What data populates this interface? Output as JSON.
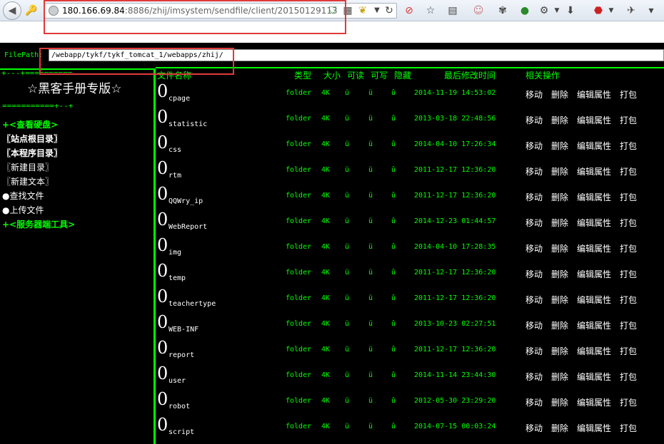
{
  "browser": {
    "url_host": "180.166.69.84",
    "url_rest": ":8886/zhij/imsystem/sendfile/client/20150129113"
  },
  "filepath": {
    "label": "FilePath:",
    "value": "/webapp/tykf/tykf_tomcat_1/webapps/zhij/"
  },
  "sidebar": {
    "title": "☆黑客手册专版☆",
    "dash_top": "+---+==========",
    "dash_bottom": "===========+--+",
    "items": [
      {
        "label": "+<查看硬盘>",
        "style": "green"
      },
      {
        "label": "〖站点根目录〗",
        "style": "white-bold"
      },
      {
        "label": "〖本程序目录〗",
        "style": "white-bold"
      },
      {
        "label": "〖新建目录〗",
        "style": "white"
      },
      {
        "label": "〖新建文本〗",
        "style": "white"
      },
      {
        "label": "●查找文件",
        "style": "white"
      },
      {
        "label": "●上传文件",
        "style": "white"
      },
      {
        "label": "+<服务器端工具>",
        "style": "green"
      }
    ]
  },
  "table": {
    "headers": {
      "name": "文件名称",
      "type": "类型",
      "size": "大小",
      "read": "可读",
      "write": "可写",
      "hidden": "隐藏",
      "modified": "最后修改时间",
      "ops": "相关操作"
    },
    "icon_char": "0",
    "perm_read": "ü",
    "perm_write": "ü",
    "perm_hidden": "û",
    "actions": [
      "移动",
      "删除",
      "编辑属性",
      "打包"
    ],
    "rows": [
      {
        "name": "cpage",
        "type": "folder",
        "size": "4K",
        "modified": "2014-11-19 14:53:02"
      },
      {
        "name": "statistic",
        "type": "folder",
        "size": "4K",
        "modified": "2013-03-18 22:48:56"
      },
      {
        "name": "css",
        "type": "folder",
        "size": "4K",
        "modified": "2014-04-10 17:26:34"
      },
      {
        "name": "rtm",
        "type": "folder",
        "size": "4K",
        "modified": "2011-12-17 12:36:20"
      },
      {
        "name": "QQWry_ip",
        "type": "folder",
        "size": "4K",
        "modified": "2011-12-17 12:36:20"
      },
      {
        "name": "WebReport",
        "type": "folder",
        "size": "4K",
        "modified": "2014-12-23 01:44:57"
      },
      {
        "name": "img",
        "type": "folder",
        "size": "4K",
        "modified": "2014-04-10 17:28:35"
      },
      {
        "name": "temp",
        "type": "folder",
        "size": "4K",
        "modified": "2011-12-17 12:36:20"
      },
      {
        "name": "teachertype",
        "type": "folder",
        "size": "4K",
        "modified": "2011-12-17 12:36:20"
      },
      {
        "name": "WEB-INF",
        "type": "folder",
        "size": "4K",
        "modified": "2013-10-23 02:27:51"
      },
      {
        "name": "report",
        "type": "folder",
        "size": "4K",
        "modified": "2011-12-17 12:36:20"
      },
      {
        "name": "user",
        "type": "folder",
        "size": "4K",
        "modified": "2014-11-14 23:44:30"
      },
      {
        "name": "robot",
        "type": "folder",
        "size": "4K",
        "modified": "2012-05-30 23:29:20"
      },
      {
        "name": "script",
        "type": "folder",
        "size": "4K",
        "modified": "2014-07-15 00:03:24"
      }
    ]
  }
}
